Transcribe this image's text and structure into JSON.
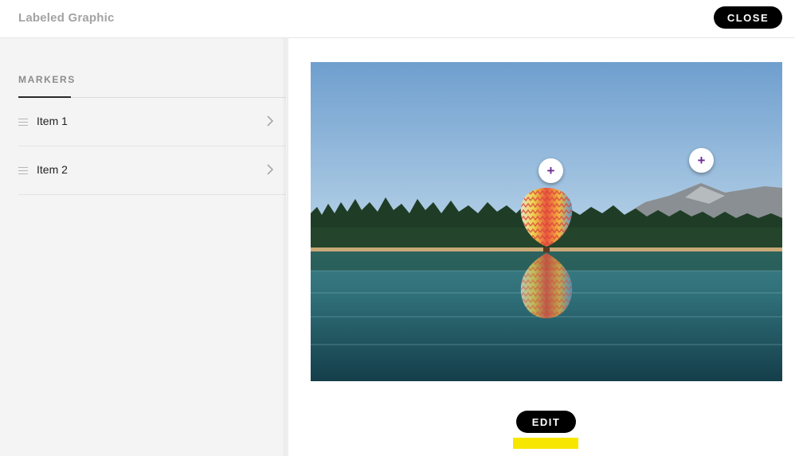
{
  "header": {
    "title": "Labeled Graphic",
    "close_label": "CLOSE"
  },
  "sidebar": {
    "tab_label": "MARKERS",
    "items": [
      {
        "label": "Item 1"
      },
      {
        "label": "Item 2"
      }
    ]
  },
  "main": {
    "hotspot_glyph": "+",
    "edit_label": "EDIT"
  },
  "colors": {
    "accent_button": "#000000",
    "hotspot_icon": "#6b2c91",
    "highlight": "#f7e600"
  },
  "icons": [
    "drag-handle-icon",
    "chevron-right-icon",
    "plus-icon"
  ]
}
